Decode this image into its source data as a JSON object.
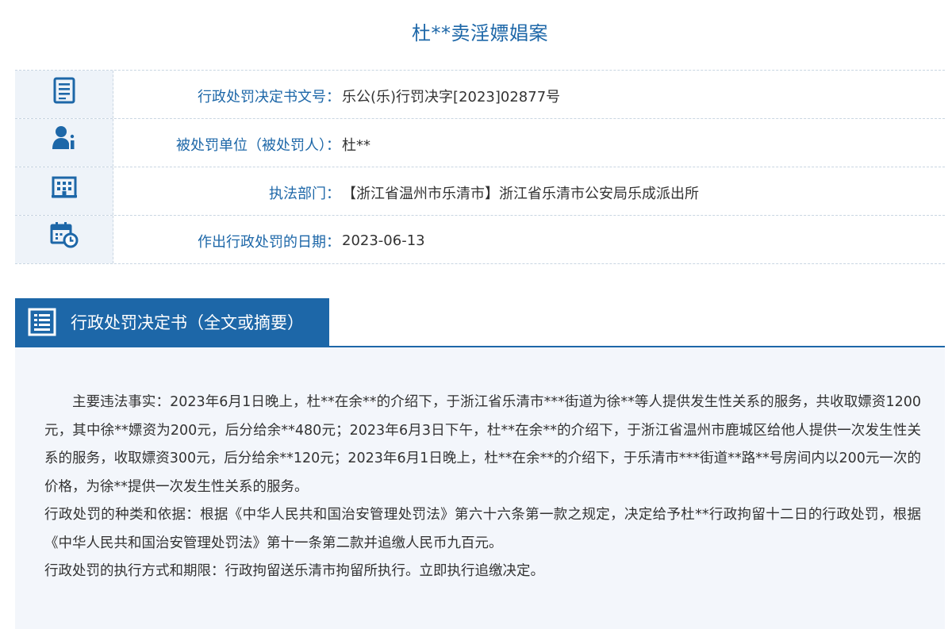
{
  "title": "杜**卖淫嫖娼案",
  "info_rows": [
    {
      "icon": "document-icon",
      "label": "行政处罚决定书文号：",
      "value": "乐公(乐)行罚决字[2023]02877号"
    },
    {
      "icon": "person-icon",
      "label": "被处罚单位（被处罚人）：",
      "value": "杜**"
    },
    {
      "icon": "building-icon",
      "label": "执法部门：",
      "value": "【浙江省温州市乐清市】浙江省乐清市公安局乐成派出所"
    },
    {
      "icon": "calendar-clock-icon",
      "label": "作出行政处罚的日期：",
      "value": "2023-06-13"
    }
  ],
  "section": {
    "icon": "document-list-icon",
    "title": "行政处罚决定书（全文或摘要）"
  },
  "content": {
    "facts": "主要违法事实：2023年6月1日晚上，杜**在余**的介绍下，于浙江省乐清市***街道为徐**等人提供发生性关系的服务，共收取嫖资1200元，其中徐**嫖资为200元，后分给余**480元；2023年6月3日下午，杜**在余**的介绍下，于浙江省温州市鹿城区给他人提供一次发生性关系的服务，收取嫖资300元，后分给余**120元；2023年6月1日晚上，杜**在余**的介绍下，于乐清市***街道**路**号房间内以200元一次的价格，为徐**提供一次发生性关系的服务。",
    "basis": "行政处罚的种类和依据：根据《中华人民共和国治安管理处罚法》第六十六条第一款之规定，决定给予杜**行政拘留十二日的行政处罚，根据《中华人民共和国治安管理处罚法》第十一条第二款并追缴人民币九百元。",
    "execution": "行政处罚的执行方式和期限：行政拘留送乐清市拘留所执行。立即执行追缴决定。"
  },
  "colors": {
    "accent": "#1d67a8",
    "icon_bg": "#eef3f9",
    "content_bg": "#f3f6fb",
    "text": "#333333"
  }
}
